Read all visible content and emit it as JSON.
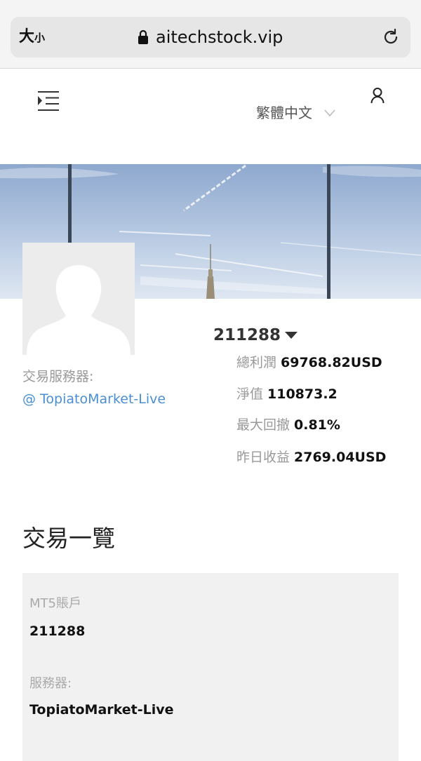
{
  "browser": {
    "text_size_label_large": "大",
    "text_size_label_small": "小",
    "url": "aitechstock.vip"
  },
  "header": {
    "language": "繁體中文"
  },
  "profile": {
    "server_label": "交易服務器:",
    "server_link": "@ TopiatoMarket-Live",
    "account_number": "211288"
  },
  "stats": [
    {
      "label": "總利潤",
      "value": "69768.82USD"
    },
    {
      "label": "淨值",
      "value": "110873.2"
    },
    {
      "label": "最大回撤",
      "value": "0.81%"
    },
    {
      "label": "昨日收益",
      "value": "2769.04USD"
    }
  ],
  "section": {
    "title": "交易一覽"
  },
  "card": {
    "account_label": "MT5賬戶",
    "account_value": "211288",
    "server_label": "服務器:",
    "server_value": "TopiatoMarket-Live"
  },
  "colors": {
    "link": "#4a8fd3",
    "card_bg": "#f1f1f1",
    "sky_top": "#8fa9cf",
    "sky_bottom": "#dce6f2"
  }
}
